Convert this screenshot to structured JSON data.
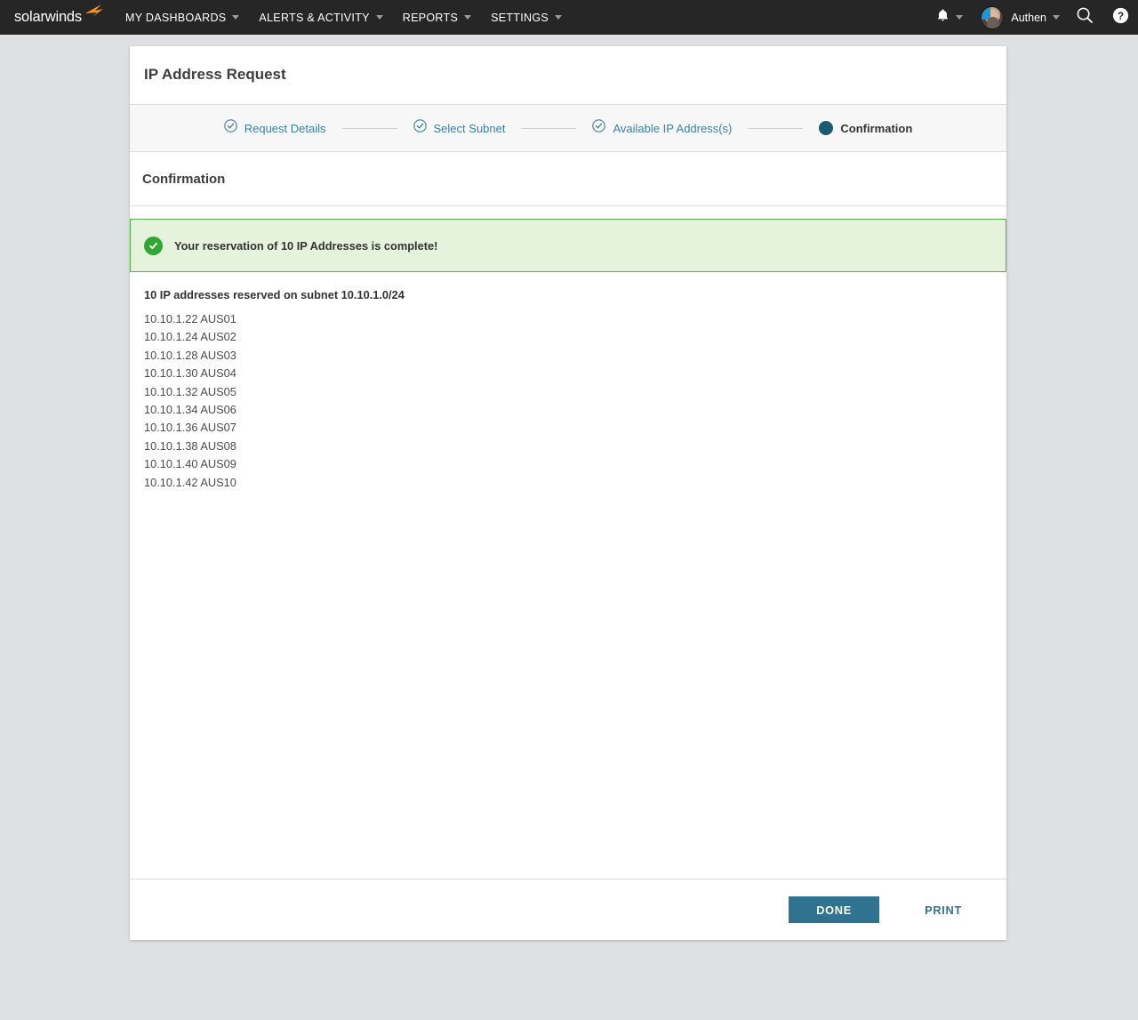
{
  "topnav": {
    "logo_text": "solarwinds",
    "logo_icon": "solarwinds-flame-icon",
    "items": [
      {
        "label": "MY DASHBOARDS",
        "has_caret": true
      },
      {
        "label": "ALERTS & ACTIVITY",
        "has_caret": true
      },
      {
        "label": "REPORTS",
        "has_caret": true
      },
      {
        "label": "SETTINGS",
        "has_caret": true
      }
    ],
    "bell_icon": "notification-bell-icon",
    "username": "Authen",
    "search_icon": "search-icon",
    "help_icon": "help-icon"
  },
  "page": {
    "title": "IP Address Request"
  },
  "wizard": {
    "steps": [
      {
        "label": "Request Details",
        "state": "complete",
        "icon": "check-circle-icon"
      },
      {
        "label": "Select Subnet",
        "state": "complete",
        "icon": "check-circle-icon"
      },
      {
        "label": "Available IP Address(s)",
        "state": "complete",
        "icon": "check-circle-icon"
      },
      {
        "label": "Confirmation",
        "state": "current",
        "icon": "filled-dot-icon"
      }
    ]
  },
  "section": {
    "heading": "Confirmation"
  },
  "banner": {
    "icon": "success-check-icon",
    "message": "Your reservation of 10 IP Addresses is complete!",
    "bg_color": "#e5f3dd",
    "border_color": "#55b54c",
    "icon_color": "#32a632"
  },
  "results": {
    "heading": "10 IP addresses reserved on subnet 10.10.1.0/24",
    "rows": [
      "10.10.1.22 AUS01",
      "10.10.1.24 AUS02",
      "10.10.1.28 AUS03",
      "10.10.1.30 AUS04",
      "10.10.1.32 AUS05",
      "10.10.1.34 AUS06",
      "10.10.1.36 AUS07",
      "10.10.1.38 AUS08",
      "10.10.1.40 AUS09",
      "10.10.1.42 AUS10"
    ]
  },
  "footer": {
    "done_label": "DONE",
    "print_label": "PRINT",
    "accent_color": "#2f7390"
  }
}
